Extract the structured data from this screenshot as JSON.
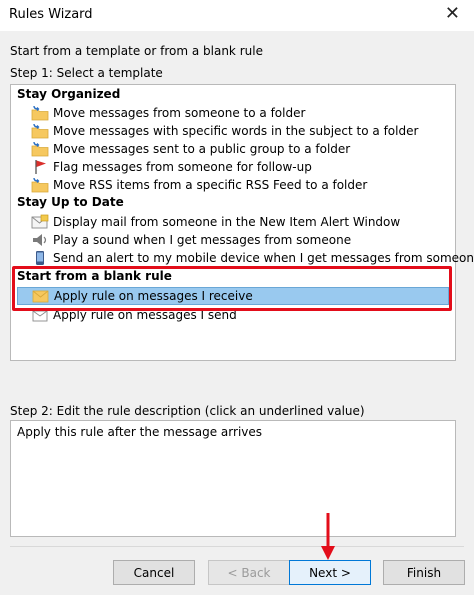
{
  "window": {
    "title": "Rules Wizard",
    "close_glyph": "✕"
  },
  "intro": "Start from a template or from a blank rule",
  "step1_label": "Step 1: Select a template",
  "groups": {
    "stay_organized": "Stay Organized",
    "stay_up_to_date": "Stay Up to Date",
    "blank_rule": "Start from a blank rule"
  },
  "items": [
    {
      "label": "Move messages from someone to a folder",
      "icon": "folder-arrow-icon"
    },
    {
      "label": "Move messages with specific words in the subject to a folder",
      "icon": "folder-arrow-icon"
    },
    {
      "label": "Move messages sent to a public group to a folder",
      "icon": "folder-arrow-icon"
    },
    {
      "label": "Flag messages from someone for follow-up",
      "icon": "red-flag-icon"
    },
    {
      "label": "Move RSS items from a specific RSS Feed to a folder",
      "icon": "folder-arrow-icon"
    },
    {
      "label": "Display mail from someone in the New Item Alert Window",
      "icon": "envelope-alert-icon"
    },
    {
      "label": "Play a sound when I get messages from someone",
      "icon": "speaker-icon"
    },
    {
      "label": "Send an alert to my mobile device when I get messages from someone",
      "icon": "mobile-phone-icon"
    },
    {
      "label": "Apply rule on messages I receive",
      "icon": "envelope-rule-icon",
      "selected": true
    },
    {
      "label": "Apply rule on messages I send",
      "icon": "envelope-send-icon"
    }
  ],
  "step2_label": "Step 2: Edit the rule description (click an underlined value)",
  "description": "Apply this rule after the message arrives",
  "buttons": {
    "cancel": "Cancel",
    "back": "< Back",
    "next": "Next >",
    "finish": "Finish"
  },
  "colors": {
    "selection": "#99c9ef",
    "highlight_box": "#e30d1a",
    "arrow": "#e30d1a"
  }
}
